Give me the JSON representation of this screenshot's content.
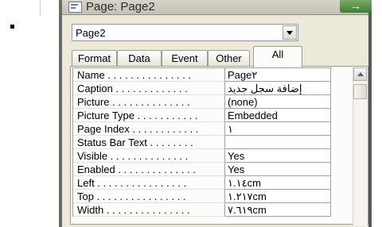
{
  "window": {
    "title": "Page: Page2",
    "close_label": "→"
  },
  "object_selector": {
    "selected": "Page2"
  },
  "tabs": [
    {
      "label": "Format"
    },
    {
      "label": "Data"
    },
    {
      "label": "Event"
    },
    {
      "label": "Other"
    },
    {
      "label": "All",
      "active": true
    }
  ],
  "properties": [
    {
      "name": "Name . . . . . . . . . . . . . . .",
      "value": "Page٢"
    },
    {
      "name": "Caption . . . . . . . . . . . . .",
      "value": "إضافة سجل جديد"
    },
    {
      "name": "Picture . . . . . . . . . . . . . .",
      "value": "(none)"
    },
    {
      "name": "Picture Type . . . . . . . . . . .",
      "value": "Embedded"
    },
    {
      "name": "Page Index . . . . . . . . . . . .",
      "value": "١"
    },
    {
      "name": "Status Bar Text . . . . . . . .",
      "value": ""
    },
    {
      "name": "Visible . . . . . . . . . . . . . .",
      "value": "Yes"
    },
    {
      "name": "Enabled . . . . . . . . . . . . . .",
      "value": "Yes"
    },
    {
      "name": "Left . . . . . . . . . . . . . . . .",
      "value": "١.١٤cm"
    },
    {
      "name": "Top . . . . . . . . . . . . . . . .",
      "value": "١.٢١٧cm"
    },
    {
      "name": "Width . . . . . . . . . . . . . . .",
      "value": "٧.٦١٩cm"
    }
  ]
}
